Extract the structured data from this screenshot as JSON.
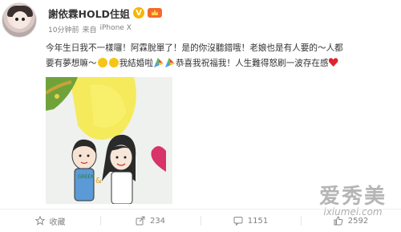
{
  "post": {
    "username": "謝依霖HOLD住姐",
    "verified_badge": "V",
    "meta": {
      "time": "10分钟前",
      "source_prefix": "来自",
      "source": "iPhone X"
    },
    "text": {
      "line1": "今年生日我不一樣囉！阿霖脫單了！是的你沒聽錯哦！老娘也是有人要的～人都",
      "line2_a": "要有夢想嘛～",
      "line2_b": "我結婚啦",
      "line2_c": "恭喜我祝福我！人生難得怒刷一波存在感"
    },
    "image": {
      "label_green": "GREEN",
      "label_amp": "&"
    }
  },
  "actions": [
    {
      "icon": "star-icon",
      "label": "收藏"
    },
    {
      "icon": "share-icon",
      "label": "234"
    },
    {
      "icon": "comment-icon",
      "label": "1151"
    },
    {
      "icon": "like-icon",
      "label": "2592"
    }
  ],
  "watermark": {
    "text": "爱秀美",
    "url": "ixiumei.com"
  },
  "colors": {
    "text": "#333333",
    "meta": "#808080",
    "badge_v": "#f7b500",
    "heart": "#e0242e"
  }
}
